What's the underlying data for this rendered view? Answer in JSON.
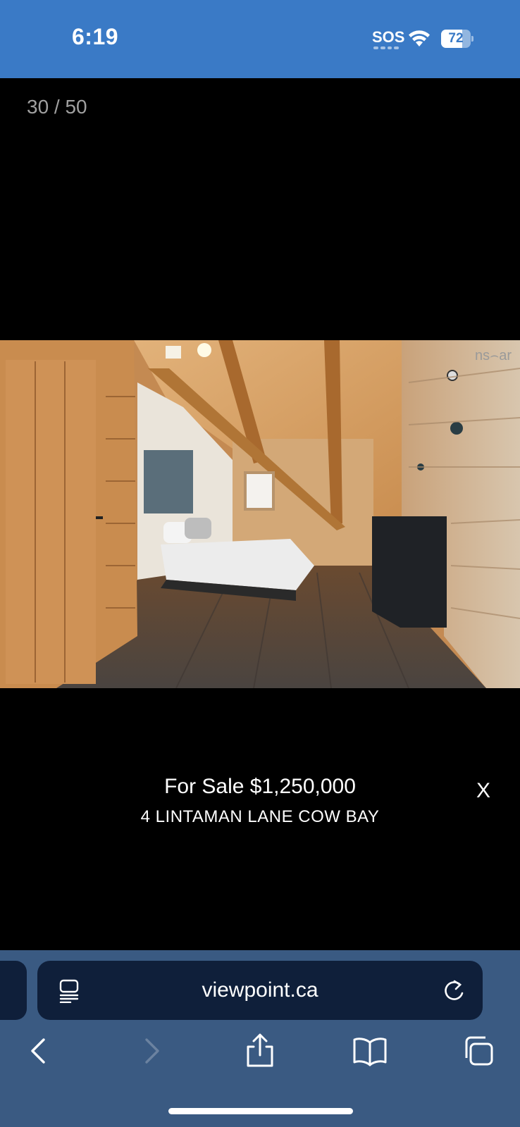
{
  "status_bar": {
    "time": "6:19",
    "sos": "SOS",
    "battery": "72",
    "battery_level": 0.72,
    "background": "#3a7ac6"
  },
  "gallery": {
    "counter": "30 / 50",
    "price": "For Sale $1,250,000",
    "address": "4 LINTAMAN LANE COW BAY",
    "close_label": "X",
    "watermark": "ns⌢ar"
  },
  "browser": {
    "url": "viewpoint.ca",
    "background": "#3a5a82",
    "address_bg": "#0f1f3a",
    "icons": [
      "reader-icon",
      "reload-icon",
      "back-icon",
      "forward-icon",
      "share-icon",
      "bookmarks-icon",
      "tabs-icon"
    ]
  }
}
